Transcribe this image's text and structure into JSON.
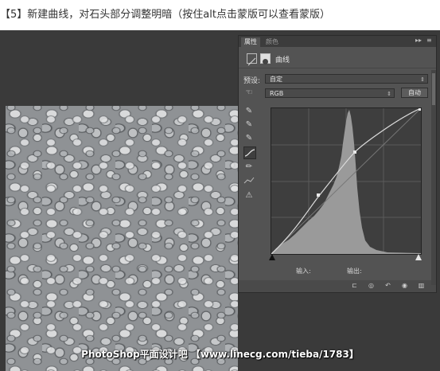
{
  "caption": "【5】新建曲线，对石头部分调整明暗（按住alt点击蒙版可以查看蒙版）",
  "watermark": "PhotoShop平面设计吧 【www.linecg.com/tieba/1783】",
  "panel": {
    "tabs": [
      {
        "label": "属性"
      },
      {
        "label": "颜色"
      }
    ],
    "topbar_controls": [
      "▸▸",
      "≡"
    ],
    "title": "曲线",
    "preset_label": "预设:",
    "preset_value": "自定",
    "channel_value": "RGB",
    "auto_button": "自动",
    "input_label": "输入:",
    "output_label": "输出:"
  },
  "icons": {
    "adjustment": "curves-adjustment-icon",
    "mask": "layer-mask-icon",
    "hand": "on-image-adjust-icon",
    "tools": [
      "black-eyedropper-icon",
      "gray-eyedropper-icon",
      "white-eyedropper-icon",
      "curve-points-icon",
      "pencil-draw-icon",
      "smooth-curve-icon",
      "clipping-warning-icon"
    ],
    "bottom": [
      "clip-to-layer-icon",
      "view-previous-icon",
      "reset-icon",
      "visibility-icon",
      "delete-icon"
    ]
  },
  "colors": {
    "panel_bg": "#535353",
    "graph_bg": "#3e3e3e",
    "histogram": "#9a9a9a",
    "curve": "#dddddd"
  }
}
